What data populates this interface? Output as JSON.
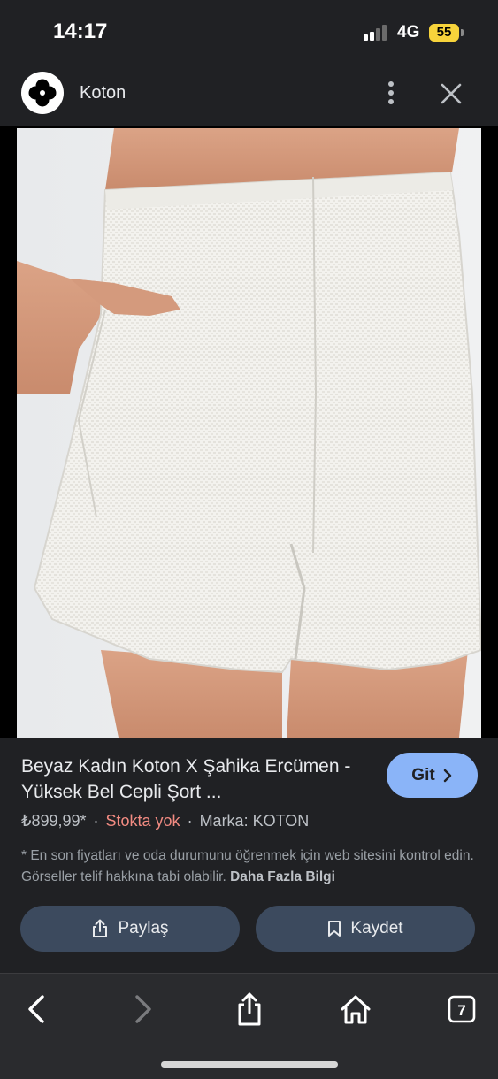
{
  "status_bar": {
    "time": "14:17",
    "network": "4G",
    "battery": "55"
  },
  "header": {
    "site_name": "Koton"
  },
  "product": {
    "title": "Beyaz Kadın Koton X Şahika Ercümen - Yüksek Bel Cepli Şort ...",
    "go_label": "Git",
    "price": "₺899,99*",
    "stock": "Stokta yok",
    "brand": "Marka: KOTON",
    "disclaimer": "* En son fiyatları ve oda durumunu öğrenmek için web sitesini kontrol edin. Görseller telif hakkına tabi olabilir.",
    "more_info": "Daha Fazla Bilgi"
  },
  "actions": {
    "share_label": "Paylaş",
    "save_label": "Kaydet"
  },
  "browser": {
    "tab_count": "7"
  },
  "colors": {
    "accent": "#8ab4f8",
    "stock_status": "#f28b82",
    "background": "#202124",
    "pill": "#3c4a5e"
  },
  "icons": [
    "koton-logo-icon",
    "more-vert-icon",
    "close-icon",
    "google-lens-icon",
    "chevron-right-icon",
    "share-icon",
    "bookmark-icon",
    "back-icon",
    "forward-icon",
    "home-icon",
    "tabs-icon"
  ]
}
